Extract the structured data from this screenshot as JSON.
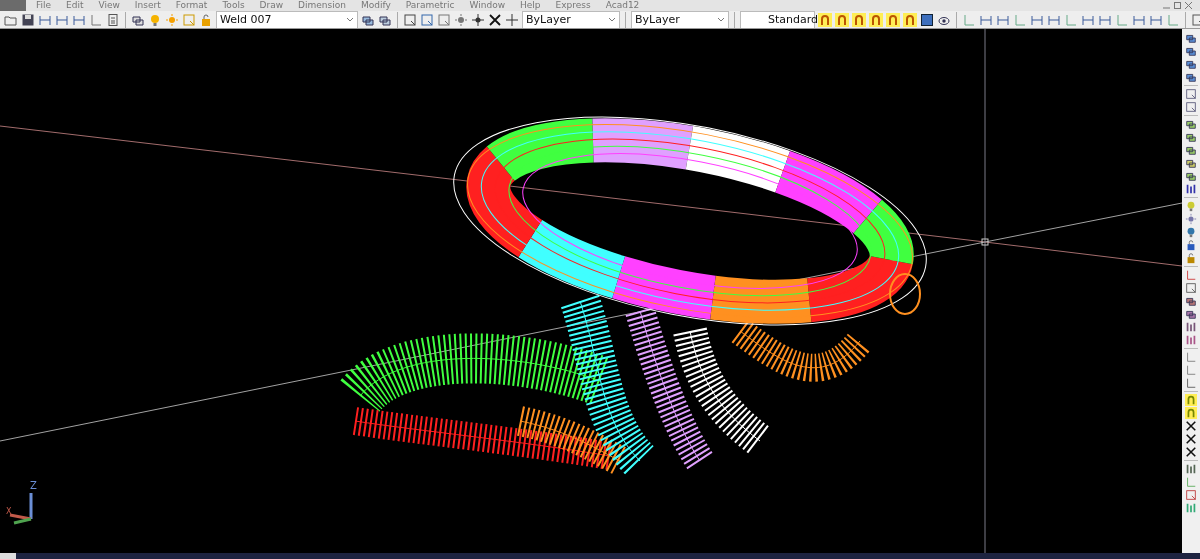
{
  "menu_bar": {
    "items": [
      "File",
      "Edit",
      "View",
      "Insert",
      "Format",
      "Tools",
      "Draw",
      "Dimension",
      "Modify",
      "Parametric",
      "Window",
      "Help",
      "Express",
      "Acad12"
    ]
  },
  "toolbar": {
    "layer_dropdown": {
      "value": "Weld 007"
    },
    "color_dropdown": {
      "value": "ByLayer"
    },
    "linetype_dropdown": {
      "value": "ByLayer"
    },
    "textstyle_dropdown": {
      "value": "Standard"
    }
  },
  "ucs_icon": {
    "z_label": "Z",
    "x_label": "X"
  }
}
